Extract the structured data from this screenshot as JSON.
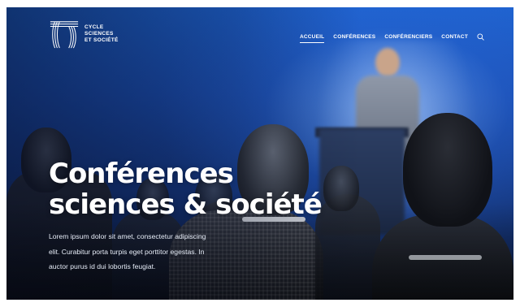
{
  "brand": {
    "lines": [
      "CYCLE",
      "SCIENCES",
      "ET SOCIÉTÉ"
    ]
  },
  "nav": {
    "items": [
      {
        "label": "ACCUEIL",
        "active": true
      },
      {
        "label": "CONFÉRENCES",
        "active": false
      },
      {
        "label": "CONFÉRENCIERS",
        "active": false
      },
      {
        "label": "CONTACT",
        "active": false
      }
    ],
    "search_icon": "search-icon"
  },
  "hero": {
    "title_line1": "Conférences",
    "title_line2": "sciences & société",
    "description": "Lorem ipsum dolor sit amet, consectetur adipiscing elit. Curabitur porta turpis eget porttitor egestas. In auctor purus id dui lobortis feugiat."
  },
  "colors": {
    "background_blue": "#1e63d0",
    "text": "#ffffff"
  }
}
